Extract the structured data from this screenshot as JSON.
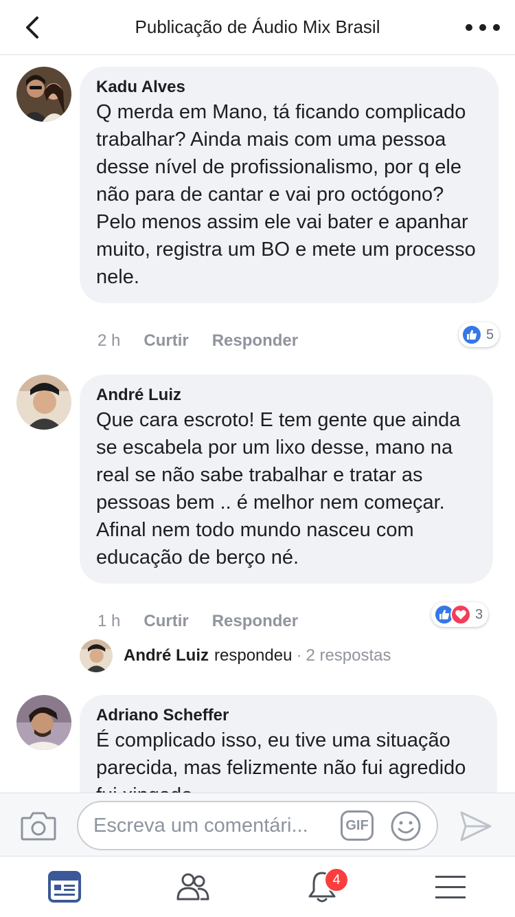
{
  "header": {
    "title": "Publicação de Áudio Mix Brasil",
    "back_icon": "chevron-left-icon",
    "more_icon": "ellipsis-icon"
  },
  "comments": [
    {
      "author": "Kadu Alves",
      "text": "Q merda em Mano, tá ficando complicado trabalhar? Ainda mais com uma pessoa desse nível de profissionalismo, por q ele não para de cantar e vai pro octógono? Pelo menos assim ele vai bater e apanhar muito, registra um BO e mete um processo nele.",
      "time": "2 h",
      "like_label": "Curtir",
      "reply_label": "Responder",
      "reaction_count": "5"
    },
    {
      "author": "André Luiz",
      "text": "Que cara escroto! E tem gente que ainda se escabela por um lixo desse, mano na real se não sabe trabalhar e tratar as pessoas bem .. é melhor nem começar.\nAfinal nem todo mundo nasceu com educação de berço né.",
      "time": "1 h",
      "like_label": "Curtir",
      "reply_label": "Responder",
      "reaction_count": "3",
      "reply_summary": {
        "name": "André Luiz",
        "verb": "respondeu",
        "separator": "·",
        "count": "2 respostas"
      }
    },
    {
      "author": "Adriano Scheffer",
      "text": "É complicado isso, eu tive uma situação parecida, mas felizmente não fui agredido fui xingado"
    }
  ],
  "composer": {
    "placeholder": "Escreva um comentári...",
    "gif_label": "GIF"
  },
  "tabbar": {
    "notifications_badge": "4"
  },
  "colors": {
    "brand_blue": "#3b5998",
    "like_blue": "#3578e5",
    "love_red": "#f33e58",
    "badge_red": "#fa3e3e",
    "bubble_gray": "#f1f2f6"
  }
}
